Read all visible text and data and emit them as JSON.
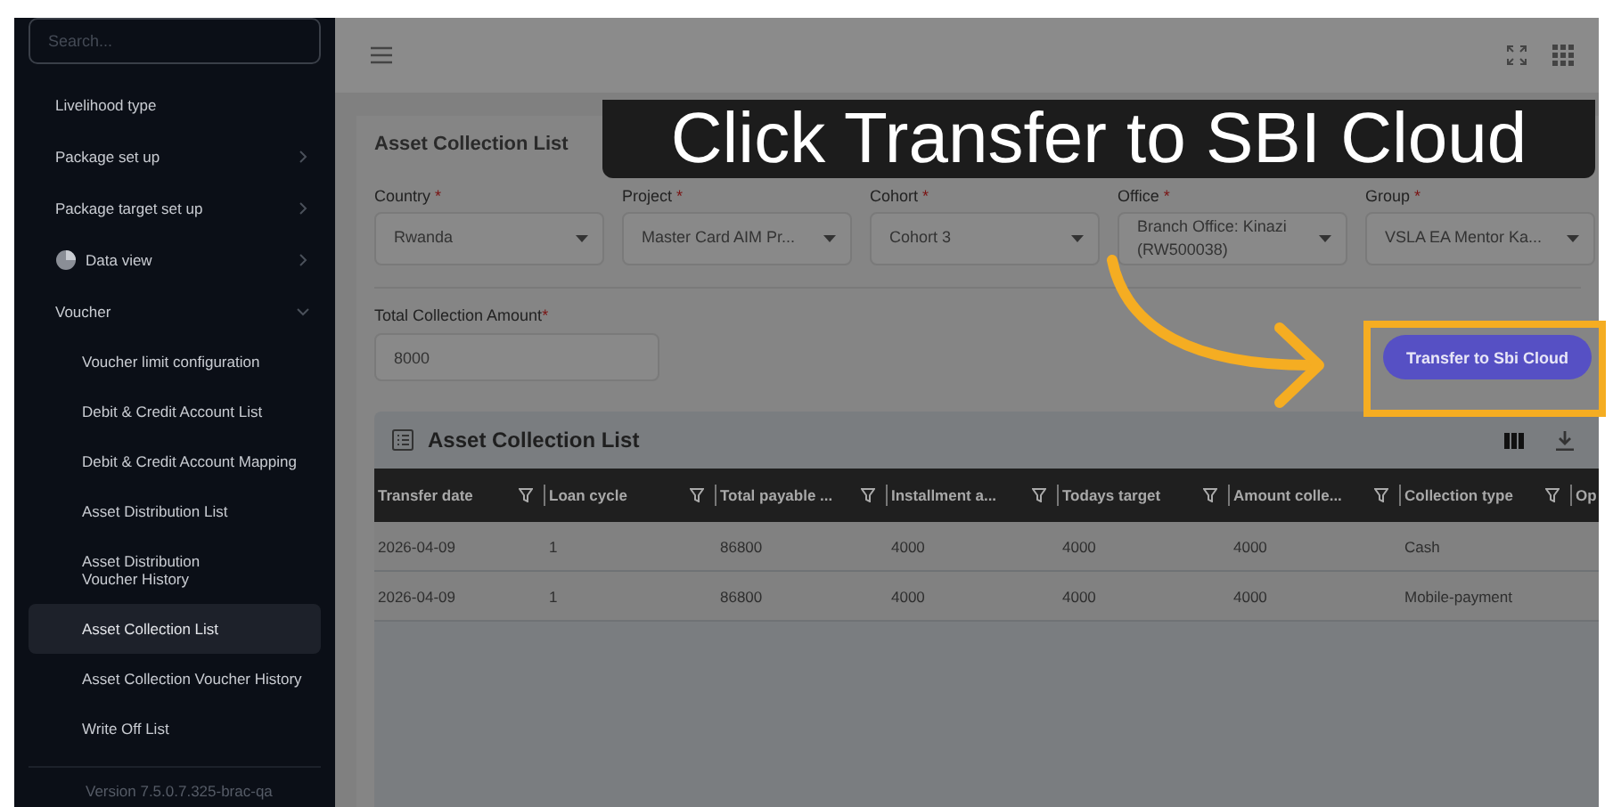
{
  "sidebar": {
    "search": {
      "placeholder": "Search..."
    },
    "items": [
      {
        "label": "Livelihood type",
        "selected": false
      },
      {
        "label": "Package set up",
        "selected": false,
        "expanded": false
      },
      {
        "label": "Package target set up",
        "selected": false,
        "expanded": false
      },
      {
        "label": "Data view",
        "kind": "chart",
        "selected": false,
        "expanded": false
      },
      {
        "label": "Voucher",
        "selected": false,
        "expanded": true,
        "children": [
          {
            "label": "Voucher limit configuration",
            "selected": false
          },
          {
            "label": "Debit & Credit Account List",
            "selected": false
          },
          {
            "label": "Debit & Credit Account Mapping",
            "selected": false
          },
          {
            "label": "Asset Distribution List",
            "selected": false
          },
          {
            "label": "Asset Distribution Voucher History",
            "selected": false
          },
          {
            "label": "Asset Collection List",
            "selected": true
          },
          {
            "label": "Asset Collection Voucher History",
            "selected": false
          },
          {
            "label": "Write Off List",
            "selected": false
          }
        ]
      }
    ],
    "version": "Version 7.5.0.7.325-brac-qa"
  },
  "callout": {
    "text": "Click Transfer to SBI Cloud"
  },
  "card": {
    "title": "Asset Collection List",
    "filters": [
      {
        "label": "Country",
        "required_mark": "*",
        "value": "Rwanda"
      },
      {
        "label": "Project",
        "required_mark": "*",
        "value": "Master Card AIM Pr..."
      },
      {
        "label": "Cohort",
        "required_mark": "*",
        "value": "Cohort 3"
      },
      {
        "label": "Office",
        "required_mark": "*",
        "value": "Branch Office: Kinazi (RW500038)"
      },
      {
        "label": "Group",
        "required_mark": "*",
        "value": "VSLA EA Mentor Ka..."
      }
    ],
    "total": {
      "label": "Total Collection Amount",
      "required_mark": "*",
      "value": "8000"
    },
    "transfer_button": "Transfer to Sbi Cloud"
  },
  "table": {
    "title": "Asset Collection List",
    "columns": [
      "Transfer date",
      "Loan cycle",
      "Total payable ...",
      "Installment a...",
      "Todays target",
      "Amount colle...",
      "Collection type",
      "Op"
    ],
    "rows": [
      [
        "2026-04-09",
        "1",
        "86800",
        "4000",
        "4000",
        "4000",
        "Cash"
      ],
      [
        "2026-04-09",
        "1",
        "86800",
        "4000",
        "4000",
        "4000",
        "Mobile-payment"
      ]
    ]
  }
}
